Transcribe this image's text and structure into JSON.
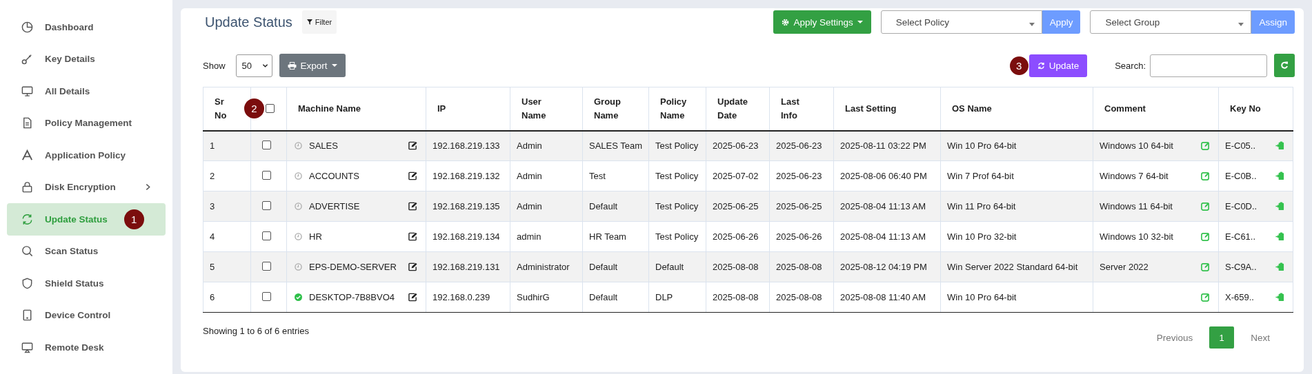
{
  "sidebar": {
    "items": [
      {
        "label": "Dashboard",
        "selected": false
      },
      {
        "label": "Key Details",
        "selected": false
      },
      {
        "label": "All Details",
        "selected": false
      },
      {
        "label": "Policy Management",
        "selected": false
      },
      {
        "label": "Application Policy",
        "selected": false
      },
      {
        "label": "Disk Encryption",
        "selected": false,
        "expandable": true
      },
      {
        "label": "Update Status",
        "selected": true,
        "marker": "1"
      },
      {
        "label": "Scan Status",
        "selected": false
      },
      {
        "label": "Shield Status",
        "selected": false
      },
      {
        "label": "Device Control",
        "selected": false
      },
      {
        "label": "Remote Desk",
        "selected": false
      }
    ]
  },
  "header": {
    "title": "Update Status",
    "filter_button": "Filter",
    "apply_settings_button": "Apply Settings",
    "policy_select": {
      "placeholder": "Select Policy"
    },
    "apply_button": "Apply",
    "group_select": {
      "placeholder": "Select Group"
    },
    "assign_button": "Assign"
  },
  "toolbar": {
    "show_label": "Show",
    "page_size": "50",
    "export_button": "Export",
    "update_button": {
      "label": "Update",
      "marker": "3"
    },
    "search_label": "Search:"
  },
  "table": {
    "columns": [
      {
        "label": "Sr No"
      },
      {
        "marker": "2"
      },
      {
        "label": "Machine Name"
      },
      {
        "label": "IP"
      },
      {
        "label": "User Name"
      },
      {
        "label": "Group Name"
      },
      {
        "label": "Policy Name"
      },
      {
        "label": "Update Date"
      },
      {
        "label": "Last Info"
      },
      {
        "label": "Last Setting"
      },
      {
        "label": "OS Name"
      },
      {
        "label": "Comment"
      },
      {
        "label": "Key No"
      }
    ],
    "header_checked": false,
    "rows": [
      {
        "sr": "1",
        "checked": false,
        "online": false,
        "machine": "SALES",
        "ip": "192.168.219.133",
        "user": "Admin",
        "group": "SALES Team",
        "policy": "Test Policy",
        "update_date": "2025-06-23",
        "last_info": "2025-06-23",
        "last_setting": "2025-08-11 03:22 PM",
        "os": "Win 10 Pro 64-bit",
        "comment": "Windows 10 64-bit",
        "key": "E-C05.."
      },
      {
        "sr": "2",
        "checked": false,
        "online": false,
        "machine": "ACCOUNTS",
        "ip": "192.168.219.132",
        "user": "Admin",
        "group": "Test",
        "policy": "Test Policy",
        "update_date": "2025-07-02",
        "last_info": "2025-06-23",
        "last_setting": "2025-08-06 06:40 PM",
        "os": "Win 7 Prof 64-bit",
        "comment": "Windows 7 64-bit",
        "key": "E-C0B.."
      },
      {
        "sr": "3",
        "checked": false,
        "online": false,
        "machine": "ADVERTISE",
        "ip": "192.168.219.135",
        "user": "Admin",
        "group": "Default",
        "policy": "Test Policy",
        "update_date": "2025-06-25",
        "last_info": "2025-06-25",
        "last_setting": "2025-08-04 11:13 AM",
        "os": "Win 11 Pro 64-bit",
        "comment": "Windows 11 64-bit",
        "key": "E-C0D.."
      },
      {
        "sr": "4",
        "checked": false,
        "online": false,
        "machine": "HR",
        "ip": "192.168.219.134",
        "user": "admin",
        "group": "HR Team",
        "policy": "Test Policy",
        "update_date": "2025-06-26",
        "last_info": "2025-06-26",
        "last_setting": "2025-08-04 11:13 AM",
        "os": "Win 10 Pro 32-bit",
        "comment": "Windows 10 32-bit",
        "key": "E-C61.."
      },
      {
        "sr": "5",
        "checked": false,
        "online": false,
        "machine": "EPS-DEMO-SERVER",
        "ip": "192.168.219.131",
        "user": "Administrator",
        "group": "Default",
        "policy": "Default",
        "update_date": "2025-08-08",
        "last_info": "2025-08-08",
        "last_setting": "2025-08-12 04:19 PM",
        "os": "Win Server 2022 Standard 64-bit",
        "comment": "Server 2022",
        "key": "S-C9A.."
      },
      {
        "sr": "6",
        "checked": false,
        "online": true,
        "machine": "DESKTOP-7B8BVO4",
        "ip": "192.168.0.239",
        "user": "SudhirG",
        "group": "Default",
        "policy": "DLP",
        "update_date": "2025-08-08",
        "last_info": "2025-08-08",
        "last_setting": "2025-08-08 11:40 AM",
        "os": "Win 10 Pro 64-bit",
        "key": "X-659.."
      }
    ]
  },
  "footer": {
    "info": "Showing 1 to 6 of 6 entries",
    "previous": "Previous",
    "pages": [
      {
        "label": "1",
        "selected": true
      }
    ],
    "next": "Next"
  }
}
